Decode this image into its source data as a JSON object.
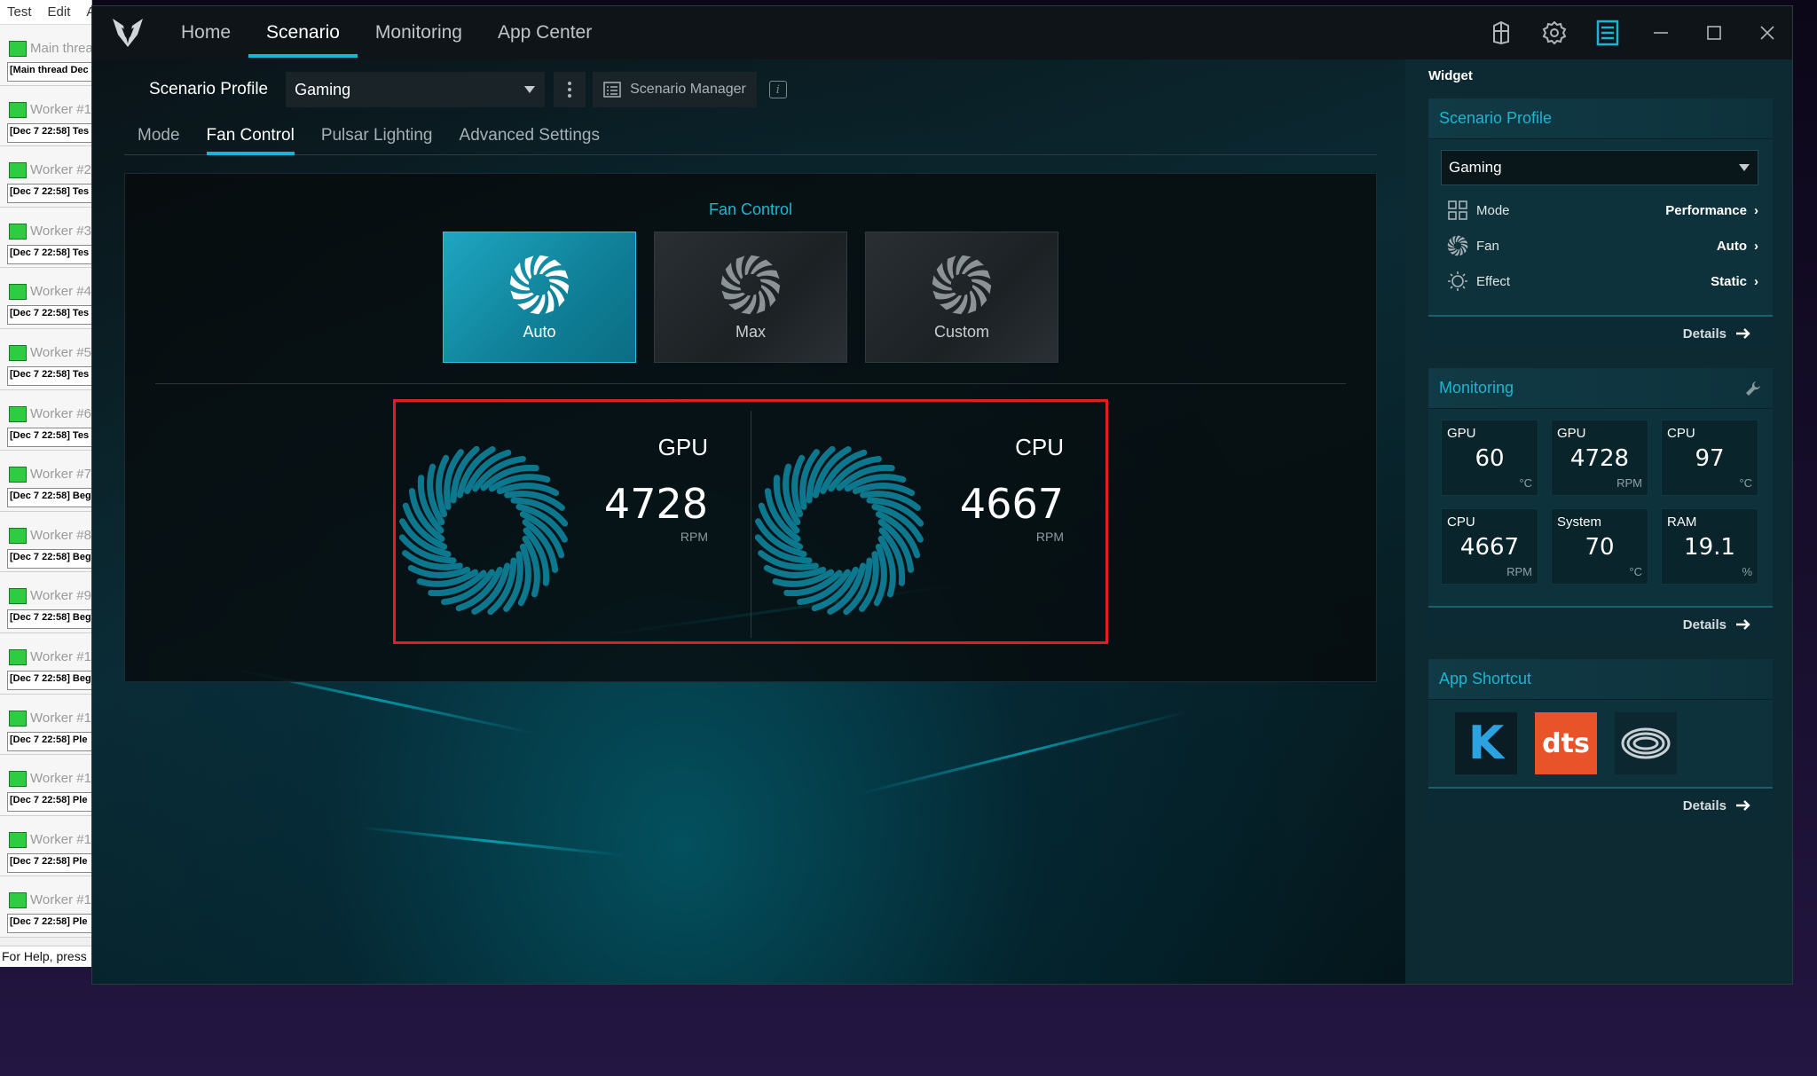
{
  "background_app": {
    "menu": [
      "Test",
      "Edit",
      "A"
    ],
    "items": [
      {
        "name": "Main threa",
        "log": "[Main thread Dec"
      },
      {
        "name": "Worker #1",
        "log": "[Dec 7 22:58] Tes"
      },
      {
        "name": "Worker #2",
        "log": "[Dec 7 22:58] Tes"
      },
      {
        "name": "Worker #3",
        "log": "[Dec 7 22:58] Tes"
      },
      {
        "name": "Worker #4",
        "log": "[Dec 7 22:58] Tes"
      },
      {
        "name": "Worker #5",
        "log": "[Dec 7 22:58] Tes"
      },
      {
        "name": "Worker #6",
        "log": "[Dec 7 22:58] Tes"
      },
      {
        "name": "Worker #7",
        "log": "[Dec 7 22:58] Beg"
      },
      {
        "name": "Worker #8",
        "log": "[Dec 7 22:58] Beg"
      },
      {
        "name": "Worker #9",
        "log": "[Dec 7 22:58] Beg"
      },
      {
        "name": "Worker #1",
        "log": "[Dec 7 22:58] Beg"
      },
      {
        "name": "Worker #1",
        "log": "[Dec 7 22:58] Ple"
      },
      {
        "name": "Worker #1",
        "log": "[Dec 7 22:58] Ple"
      },
      {
        "name": "Worker #1",
        "log": "[Dec 7 22:58] Ple"
      },
      {
        "name": "Worker #1",
        "log": "[Dec 7 22:58] Ple"
      }
    ],
    "status": "For Help, press"
  },
  "nav": {
    "items": [
      {
        "label": "Home",
        "active": false
      },
      {
        "label": "Scenario",
        "active": true
      },
      {
        "label": "Monitoring",
        "active": false
      },
      {
        "label": "App Center",
        "active": false
      }
    ]
  },
  "profile": {
    "label": "Scenario Profile",
    "selected": "Gaming",
    "manager_label": "Scenario Manager",
    "info_glyph": "i"
  },
  "subtabs": [
    {
      "label": "Mode",
      "active": false
    },
    {
      "label": "Fan Control",
      "active": true
    },
    {
      "label": "Pulsar Lighting",
      "active": false
    },
    {
      "label": "Advanced Settings",
      "active": false
    }
  ],
  "fan_control": {
    "title": "Fan Control",
    "modes": [
      {
        "label": "Auto",
        "active": true
      },
      {
        "label": "Max",
        "active": false
      },
      {
        "label": "Custom",
        "active": false
      }
    ],
    "fans": [
      {
        "name": "GPU",
        "rpm": "4728",
        "unit": "RPM"
      },
      {
        "name": "CPU",
        "rpm": "4667",
        "unit": "RPM"
      }
    ]
  },
  "widget": {
    "title": "Widget",
    "details_label": "Details",
    "scenario": {
      "title": "Scenario Profile",
      "selected": "Gaming",
      "rows": [
        {
          "label": "Mode",
          "value": "Performance"
        },
        {
          "label": "Fan",
          "value": "Auto"
        },
        {
          "label": "Effect",
          "value": "Static"
        }
      ]
    },
    "monitoring": {
      "title": "Monitoring",
      "cells": [
        {
          "label": "GPU",
          "value": "60",
          "unit": "°C"
        },
        {
          "label": "GPU",
          "value": "4728",
          "unit": "RPM"
        },
        {
          "label": "CPU",
          "value": "97",
          "unit": "°C"
        },
        {
          "label": "CPU",
          "value": "4667",
          "unit": "RPM"
        },
        {
          "label": "System",
          "value": "70",
          "unit": "°C"
        },
        {
          "label": "RAM",
          "value": "19.1",
          "unit": "%"
        }
      ]
    },
    "shortcuts": {
      "title": "App Shortcut",
      "apps": [
        {
          "glyph": "K",
          "color": "#1e8fd0"
        },
        {
          "glyph": "dts",
          "color": "#e8532a"
        },
        {
          "glyph": "",
          "color": "#c8d0d3"
        }
      ]
    }
  },
  "colors": {
    "accent": "#17b6d4",
    "highlight_box": "#e02020"
  }
}
